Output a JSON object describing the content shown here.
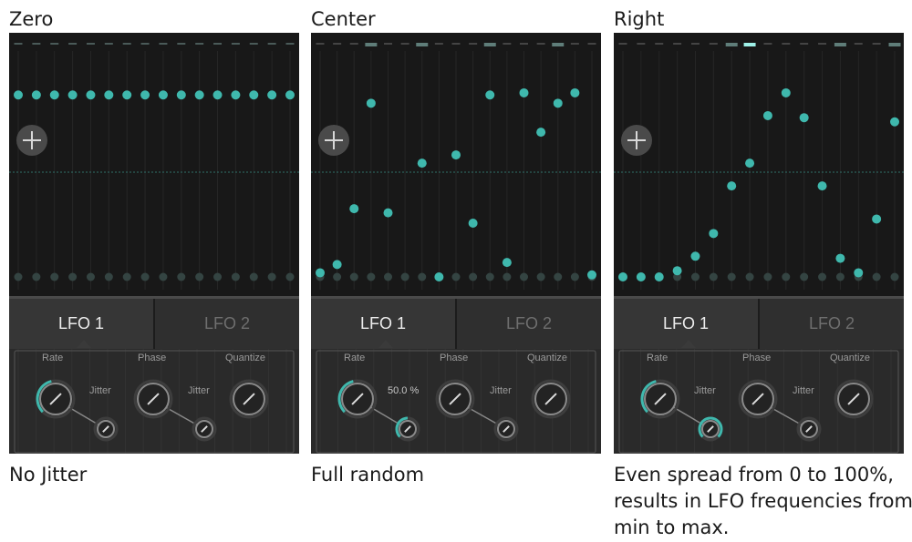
{
  "panels": [
    {
      "title": "Zero",
      "caption": "No Jitter",
      "value_label": "Jitter",
      "steps": [
        {
          "v": 0.88,
          "active": true
        },
        {
          "v": 0.88,
          "active": true
        },
        {
          "v": 0.88,
          "active": true
        },
        {
          "v": 0.88,
          "active": true
        },
        {
          "v": 0.88,
          "active": true
        },
        {
          "v": 0.88,
          "active": true
        },
        {
          "v": 0.88,
          "active": true
        },
        {
          "v": 0.88,
          "active": true
        },
        {
          "v": 0.88,
          "active": true
        },
        {
          "v": 0.88,
          "active": true
        },
        {
          "v": 0.88,
          "active": true
        },
        {
          "v": 0.88,
          "active": true
        },
        {
          "v": 0.88,
          "active": true
        },
        {
          "v": 0.88,
          "active": true
        },
        {
          "v": 0.88,
          "active": true
        },
        {
          "v": 0.88,
          "active": true
        }
      ],
      "rate_jitter_level": 0.0,
      "highlight": []
    },
    {
      "title": "Center",
      "caption": "Full random",
      "value_label": "50.0 %",
      "steps": [
        {
          "v": 0.02,
          "active": true
        },
        {
          "v": 0.06,
          "active": true
        },
        {
          "v": 0.33,
          "active": true
        },
        {
          "v": 0.84,
          "active": true
        },
        {
          "v": 0.31,
          "active": true
        },
        {
          "v": 0.0,
          "active": false
        },
        {
          "v": 0.55,
          "active": true
        },
        {
          "v": 0.0,
          "active": true
        },
        {
          "v": 0.59,
          "active": true
        },
        {
          "v": 0.26,
          "active": true
        },
        {
          "v": 0.88,
          "active": true
        },
        {
          "v": 0.07,
          "active": true
        },
        {
          "v": 0.89,
          "active": true
        },
        {
          "v": 0.7,
          "active": true
        },
        {
          "v": 0.84,
          "active": true
        },
        {
          "v": 0.89,
          "active": true
        },
        {
          "v": 0.01,
          "active": true
        }
      ],
      "rate_jitter_level": 0.5,
      "highlight": [
        3,
        6,
        10,
        14
      ]
    },
    {
      "title": "Right",
      "caption": "Even spread from 0 to 100%, results in LFO frequencies from min to max.",
      "value_label": "Jitter",
      "steps": [
        {
          "v": 0.0,
          "active": true
        },
        {
          "v": 0.0,
          "active": true
        },
        {
          "v": 0.0,
          "active": true
        },
        {
          "v": 0.03,
          "active": true
        },
        {
          "v": 0.1,
          "active": true
        },
        {
          "v": 0.21,
          "active": true
        },
        {
          "v": 0.44,
          "active": true
        },
        {
          "v": 0.55,
          "active": true
        },
        {
          "v": 0.78,
          "active": true
        },
        {
          "v": 0.89,
          "active": true
        },
        {
          "v": 0.77,
          "active": true
        },
        {
          "v": 0.44,
          "active": true
        },
        {
          "v": 0.09,
          "active": true
        },
        {
          "v": 0.02,
          "active": true
        },
        {
          "v": 0.28,
          "active": true
        },
        {
          "v": 0.75,
          "active": true
        }
      ],
      "rate_jitter_level": 1.0,
      "highlight": [
        6,
        7,
        12,
        15
      ]
    }
  ],
  "tabs": {
    "lfo1": "LFO 1",
    "lfo2": "LFO 2"
  },
  "knob_labels": {
    "rate": "Rate",
    "phase": "Phase",
    "quantize": "Quantize",
    "jitter": "Jitter"
  },
  "colors": {
    "accent": "#3fb8ad",
    "dim_dot": "#3a4a48",
    "background": "#181818"
  }
}
